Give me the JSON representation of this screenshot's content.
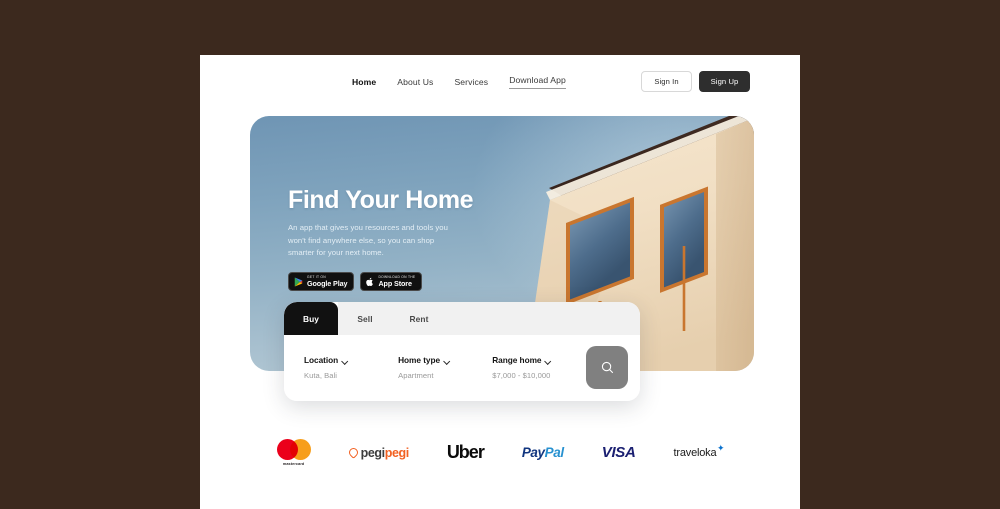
{
  "background_color": "#3C291E",
  "nav": {
    "links": [
      {
        "label": "Home",
        "active": true,
        "underlined": false
      },
      {
        "label": "About Us",
        "active": false,
        "underlined": false
      },
      {
        "label": "Services",
        "active": false,
        "underlined": false
      },
      {
        "label": "Download App",
        "active": false,
        "underlined": true
      }
    ],
    "sign_in_label": "Sign In",
    "sign_up_label": "Sign Up"
  },
  "hero": {
    "title": "Find Your Home",
    "subtitle": "An app that gives you resources and tools you won't find anywhere else, so you can shop smarter for your next home.",
    "badges": [
      {
        "small": "GET IT ON",
        "big": "Google Play",
        "icon": "google-play-icon"
      },
      {
        "small": "Download on the",
        "big": "App Store",
        "icon": "apple-icon"
      }
    ],
    "image_alt": "modern cream house with dark roof against blue sky"
  },
  "search": {
    "tabs": [
      {
        "label": "Buy",
        "active": true
      },
      {
        "label": "Sell",
        "active": false
      },
      {
        "label": "Rent",
        "active": false
      }
    ],
    "filters": [
      {
        "label": "Location",
        "value": "Kuta, Bali"
      },
      {
        "label": "Home type",
        "value": "Apartment"
      },
      {
        "label": "Range home",
        "value": "$7,000 - $10,000"
      }
    ],
    "search_icon": "search-icon",
    "search_button_color": "#808080"
  },
  "partners": [
    {
      "name": "mastercard",
      "text": "mastercard"
    },
    {
      "name": "pegipegi",
      "text_dark": "pegi",
      "text_accent": "pegi"
    },
    {
      "name": "uber",
      "text": "Uber"
    },
    {
      "name": "paypal",
      "text_dark": "Pay",
      "text_accent": "Pal"
    },
    {
      "name": "visa",
      "text": "VISA"
    },
    {
      "name": "traveloka",
      "text": "traveloka"
    }
  ],
  "colors": {
    "mastercard_red": "#EB001B",
    "mastercard_orange": "#F79E1B",
    "pegipegi_orange": "#F26122",
    "paypal_dark": "#10357F",
    "paypal_light": "#2791D0",
    "visa_blue": "#1A1F71",
    "traveloka_blue": "#0770CD",
    "dark_button": "#2E2E2E",
    "tab_active": "#111111"
  }
}
